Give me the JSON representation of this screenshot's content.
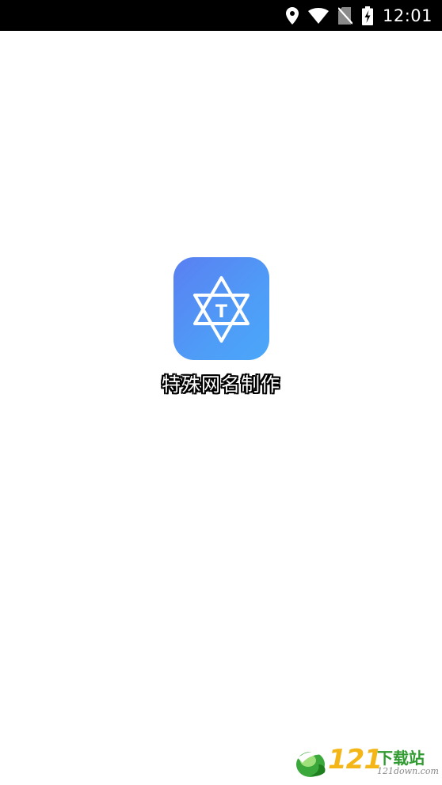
{
  "status_bar": {
    "time": "12:01",
    "icons": [
      "location-icon",
      "wifi-icon",
      "no-sim-icon",
      "battery-charging-icon"
    ]
  },
  "splash": {
    "app_name": "特殊网名制作",
    "icon_letter": "T",
    "icon_colors": {
      "start": "#5a7ff2",
      "end": "#4aa7f9"
    }
  },
  "watermark": {
    "number": "121",
    "chinese": "下载站",
    "url": "121down.com",
    "colors": {
      "number": "#f4b616",
      "chinese": "#2f9a2f"
    }
  }
}
